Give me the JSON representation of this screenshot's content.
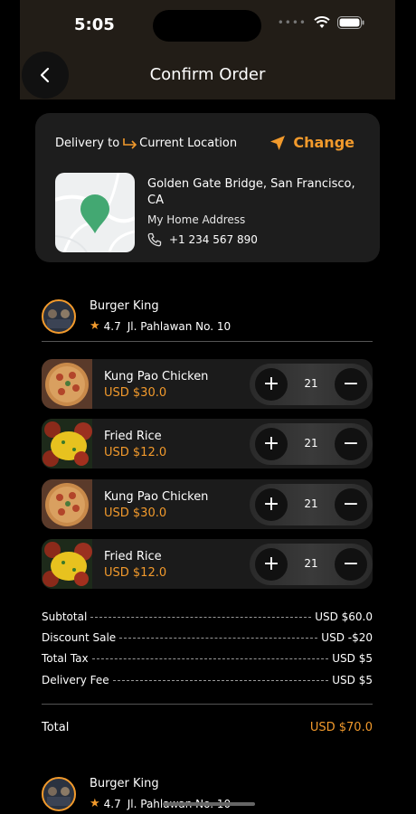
{
  "status_bar": {
    "time": "5:05"
  },
  "header": {
    "title": "Confirm Order"
  },
  "delivery": {
    "label": "Delivery to",
    "location": "Current Location",
    "change_label": "Change",
    "address": "Golden Gate Bridge, San Francisco, CA",
    "address_label": "My Home Address",
    "phone": "+1 234 567 890"
  },
  "store": {
    "name": "Burger King",
    "rating": "4.7",
    "address": "Jl. Pahlawan No. 10"
  },
  "items": [
    {
      "name": "Kung Pao Chicken",
      "price": "USD $30.0",
      "qty": "21",
      "image": "pizza"
    },
    {
      "name": "Fried Rice",
      "price": "USD $12.0",
      "qty": "21",
      "image": "fried-rice"
    },
    {
      "name": "Kung Pao Chicken",
      "price": "USD $30.0",
      "qty": "21",
      "image": "pizza"
    },
    {
      "name": "Fried Rice",
      "price": "USD $12.0",
      "qty": "21",
      "image": "fried-rice"
    }
  ],
  "summary": {
    "subtotal_label": "Subtotal",
    "subtotal": "USD $60.0",
    "discount_label": "Discount Sale",
    "discount": "USD -$20",
    "tax_label": "Total Tax",
    "tax": "USD $5",
    "delivery_label": "Delivery Fee",
    "delivery": "USD $5",
    "total_label": "Total",
    "total": "USD $70.0"
  },
  "store2": {
    "name": "Burger King",
    "rating": "4.7",
    "address": "Jl. Pahlawan No. 10"
  },
  "colors": {
    "accent": "#f29a2c",
    "background": "#000000",
    "card": "#1d1d1d",
    "header": "#221d17",
    "pin": "#43a872"
  }
}
